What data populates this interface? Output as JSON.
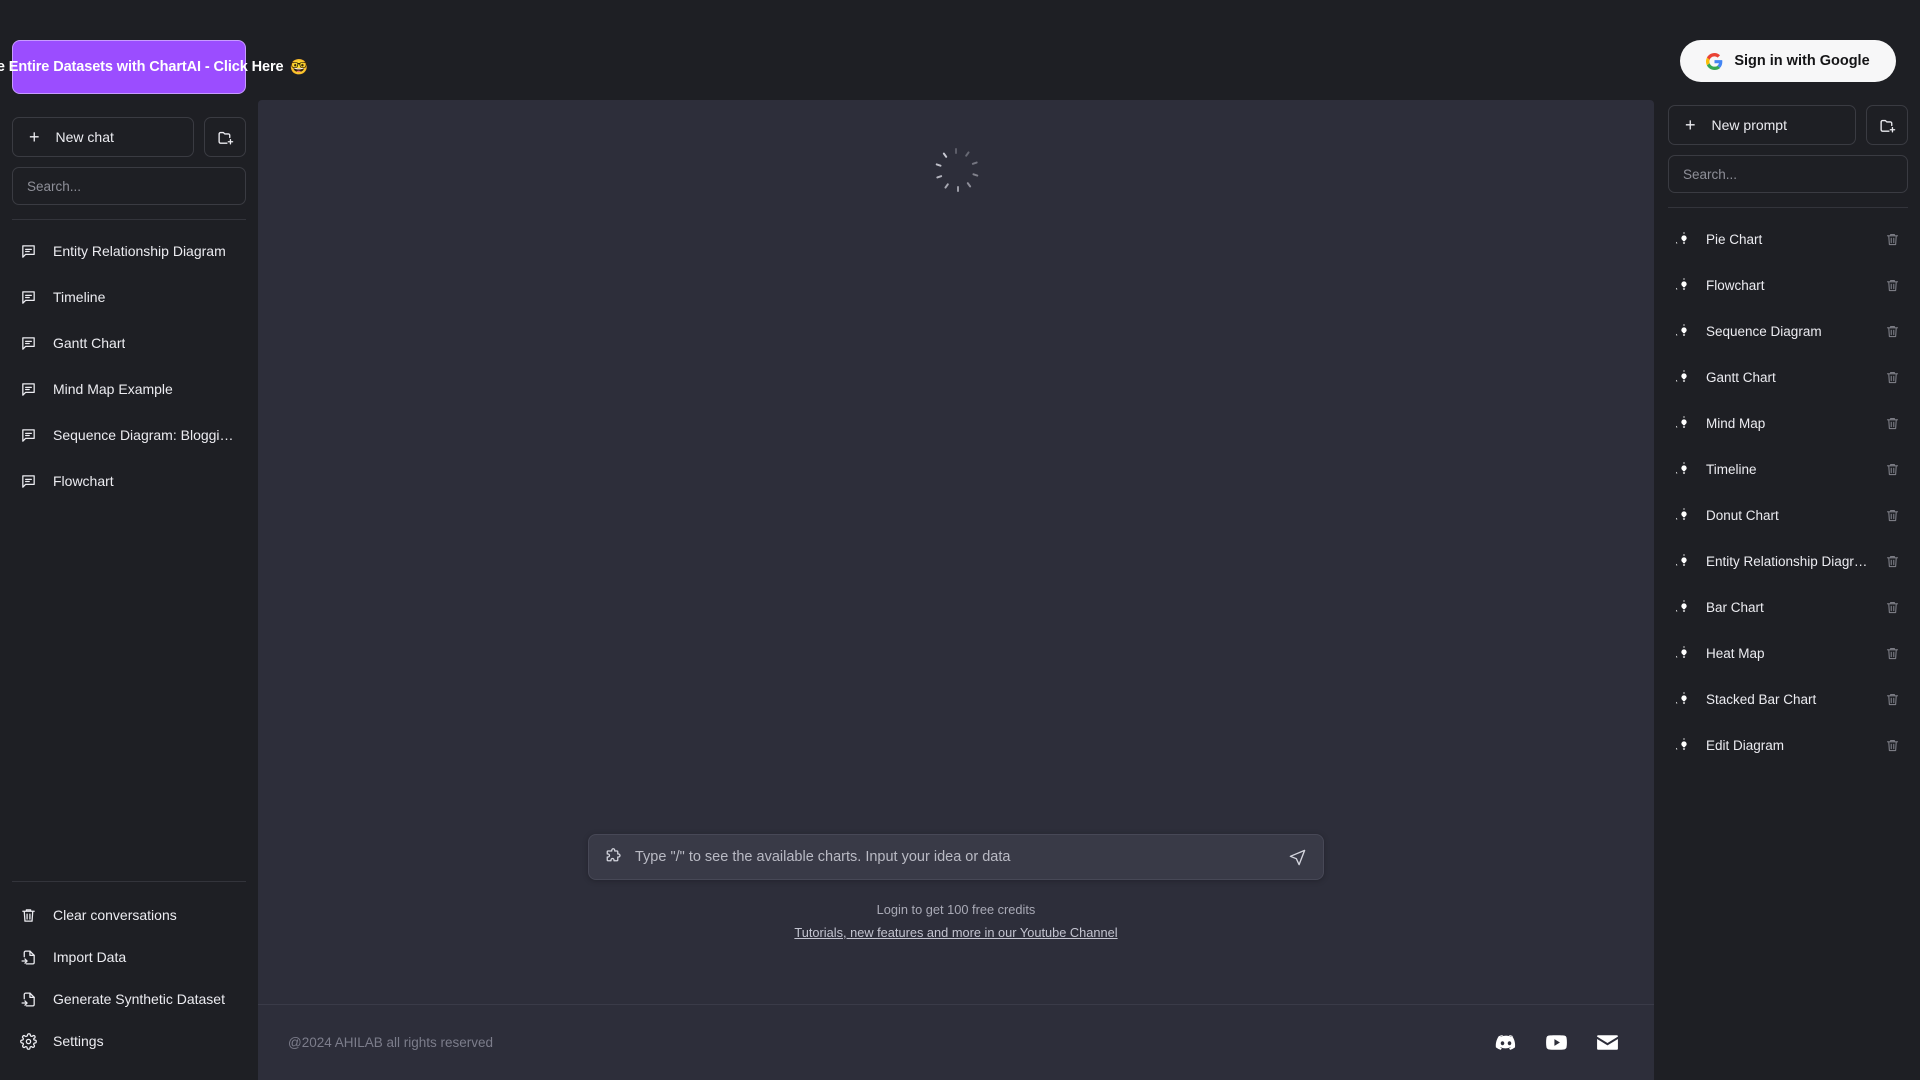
{
  "promo": {
    "text": "Analyse Entire Datasets with ChartAI - Click Here",
    "emoji": "🤓",
    "color": "#9b4dff"
  },
  "sidebar": {
    "new_chat_label": "New chat",
    "new_folder_icon": "folder-plus-icon",
    "search_placeholder": "Search...",
    "chats": [
      {
        "label": "Entity Relationship Diagram",
        "icon": "message-icon"
      },
      {
        "label": "Timeline",
        "icon": "message-icon"
      },
      {
        "label": "Gantt Chart",
        "icon": "message-icon"
      },
      {
        "label": "Mind Map Example",
        "icon": "message-icon"
      },
      {
        "label": "Sequence Diagram: Blogging ...",
        "icon": "message-icon"
      },
      {
        "label": "Flowchart",
        "icon": "message-icon"
      }
    ],
    "actions": [
      {
        "label": "Clear conversations",
        "icon": "trash-icon"
      },
      {
        "label": "Import Data",
        "icon": "file-import-icon"
      },
      {
        "label": "Generate Synthetic Dataset",
        "icon": "file-import-icon"
      },
      {
        "label": "Settings",
        "icon": "gear-icon"
      }
    ]
  },
  "main": {
    "loading_icon": "spinner-icon",
    "composer": {
      "left_icon": "puzzle-piece-icon",
      "placeholder": "Type \"/\" to see the available charts. Input your idea or data",
      "send_icon": "send-icon"
    },
    "credits_text": "Login to get 100 free credits",
    "tutorial_link": "Tutorials, new features and more in our Youtube Channel"
  },
  "footer": {
    "copyright": "@2024 AHILAB all rights reserved",
    "socials": [
      {
        "name": "discord-icon"
      },
      {
        "name": "youtube-icon"
      },
      {
        "name": "email-icon"
      }
    ]
  },
  "rightbar": {
    "signin_label": "Sign in with Google",
    "signin_icon": "google-icon",
    "new_prompt_label": "New prompt",
    "new_folder_icon": "folder-plus-icon",
    "search_placeholder": "Search...",
    "prompts": [
      {
        "label": "Pie Chart",
        "icon": "lightbulb-icon"
      },
      {
        "label": "Flowchart",
        "icon": "lightbulb-icon"
      },
      {
        "label": "Sequence Diagram",
        "icon": "lightbulb-icon"
      },
      {
        "label": "Gantt Chart",
        "icon": "lightbulb-icon"
      },
      {
        "label": "Mind Map",
        "icon": "lightbulb-icon"
      },
      {
        "label": "Timeline",
        "icon": "lightbulb-icon"
      },
      {
        "label": "Donut Chart",
        "icon": "lightbulb-icon"
      },
      {
        "label": "Entity Relationship Diagram",
        "icon": "lightbulb-icon"
      },
      {
        "label": "Bar Chart",
        "icon": "lightbulb-icon"
      },
      {
        "label": "Heat Map",
        "icon": "lightbulb-icon"
      },
      {
        "label": "Stacked Bar Chart",
        "icon": "lightbulb-icon"
      },
      {
        "label": "Edit Diagram",
        "icon": "lightbulb-icon"
      }
    ],
    "delete_icon": "trash-icon"
  }
}
